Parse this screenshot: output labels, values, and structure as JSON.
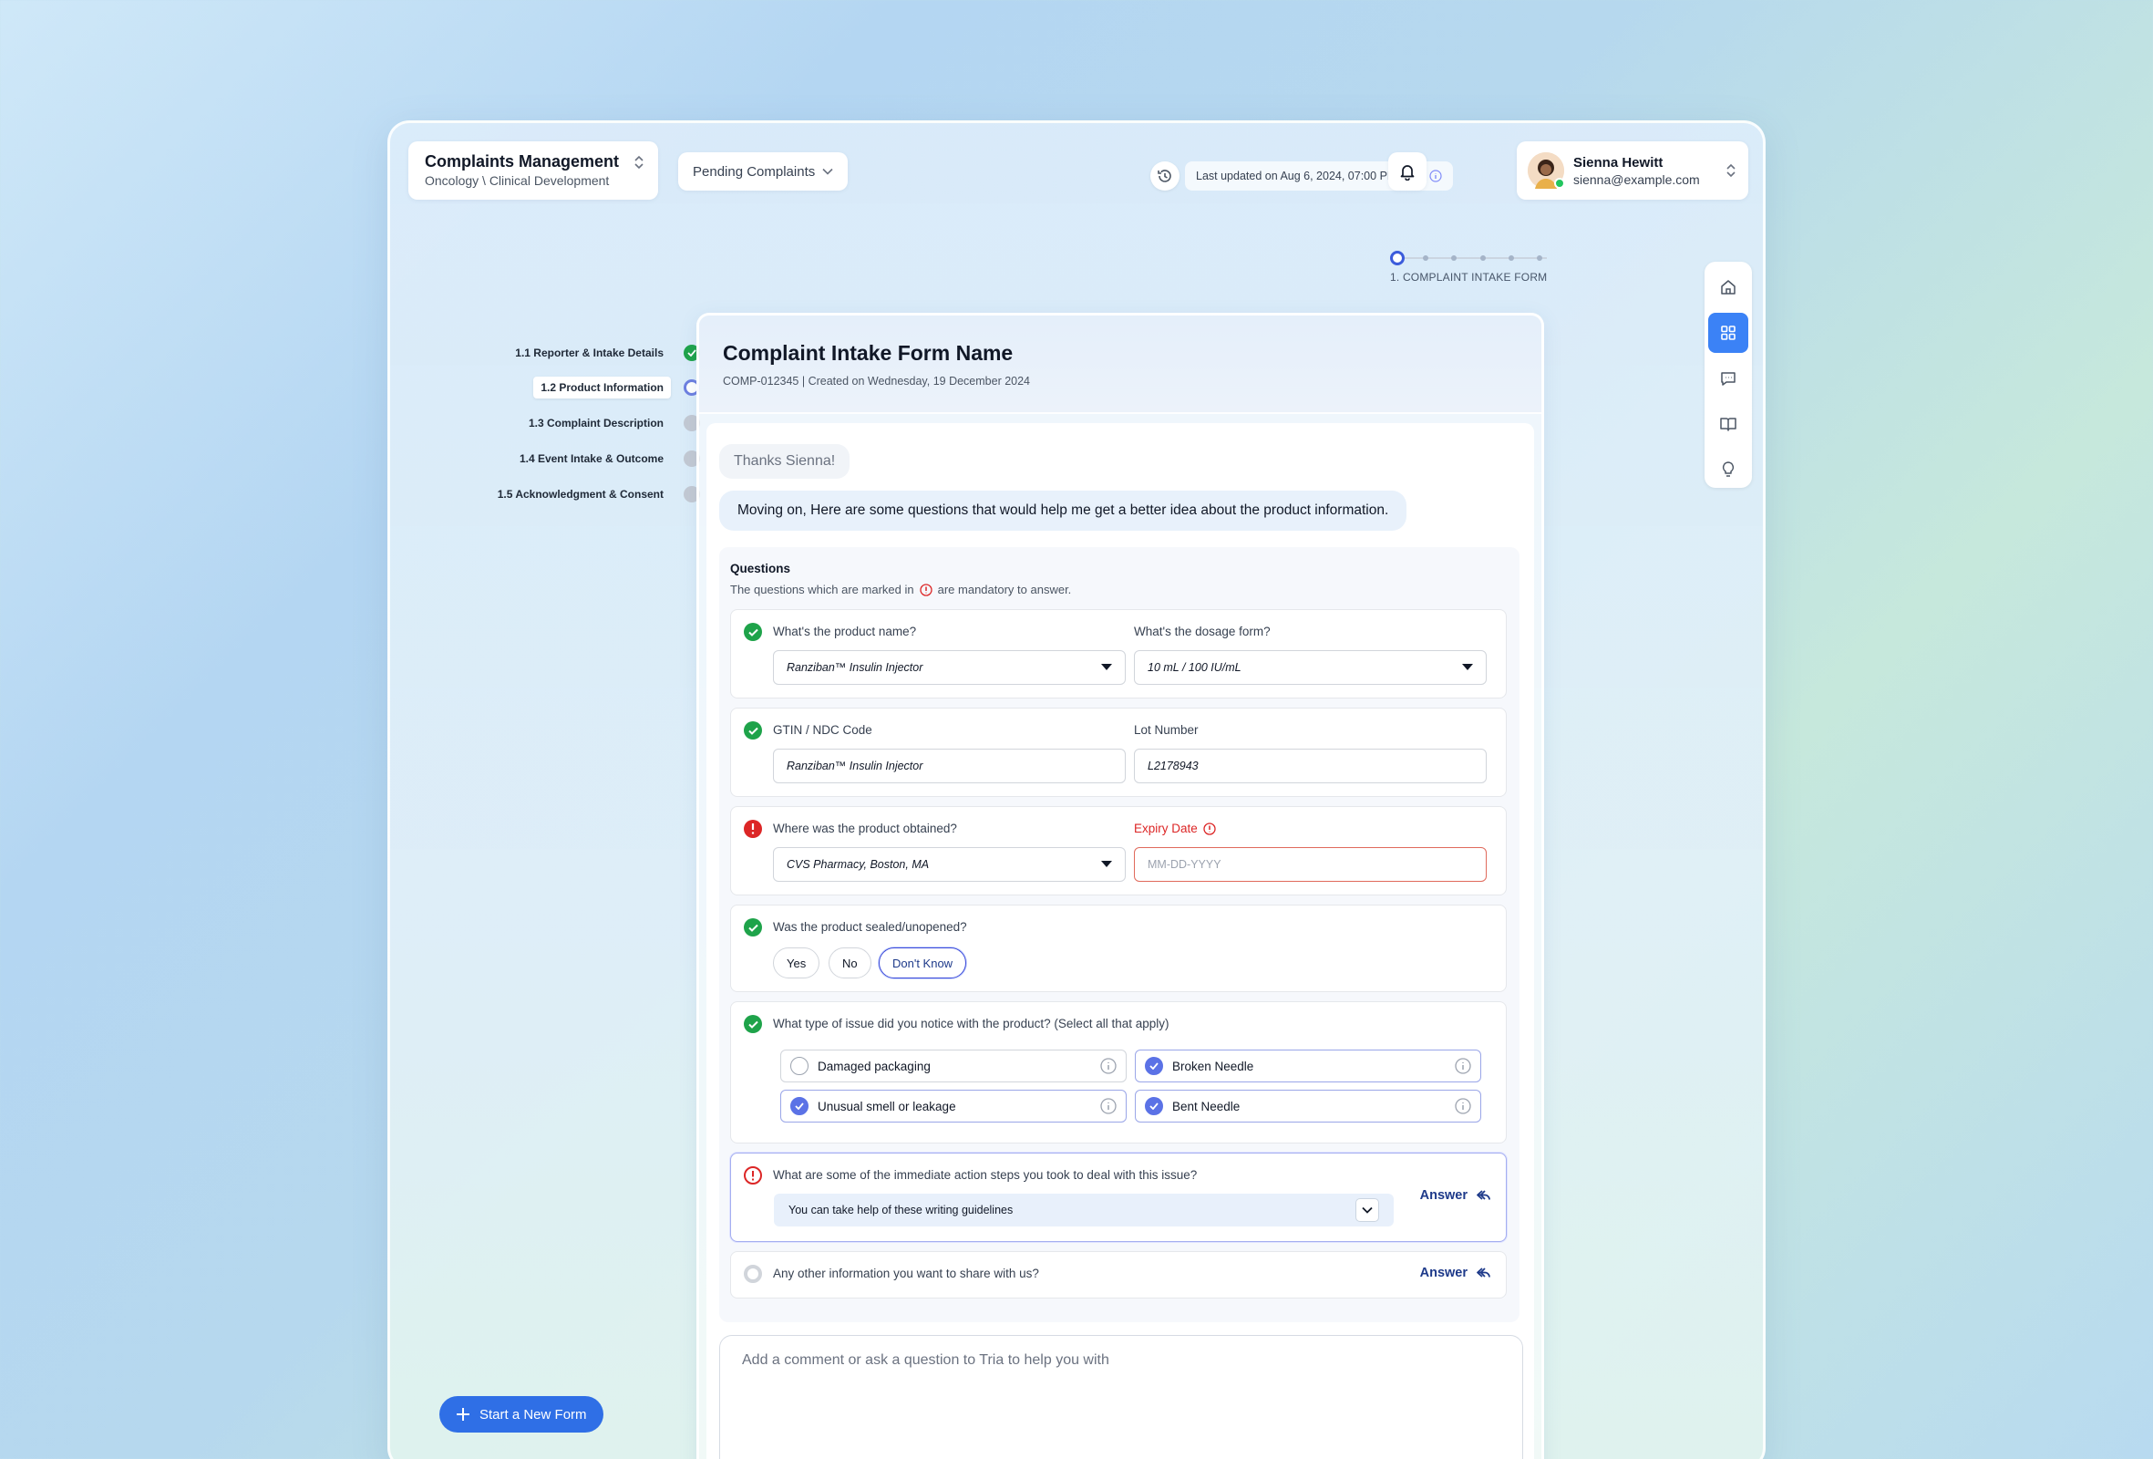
{
  "header": {
    "app_title": "Complaints Management",
    "breadcrumb": "Oncology \\ Clinical Development",
    "filter_label": "Pending Complaints",
    "last_updated": "Last updated on Aug 6, 2024, 07:00 PM EST",
    "user": {
      "name": "Sienna Hewitt",
      "email": "sienna@example.com"
    }
  },
  "stepper": {
    "label": "1. COMPLAINT INTAKE FORM",
    "total": 6,
    "current": 1
  },
  "side_steps": [
    {
      "label": "1.1 Reporter & Intake Details",
      "status": "done"
    },
    {
      "label": "1.2 Product Information",
      "status": "current"
    },
    {
      "label": "1.3 Complaint Description",
      "status": "todo"
    },
    {
      "label": "1.4 Event Intake & Outcome",
      "status": "todo"
    },
    {
      "label": "1.5 Acknowledgment & Consent",
      "status": "todo"
    }
  ],
  "new_form_label": "Start a New Form",
  "form": {
    "title": "Complaint Intake Form Name",
    "subtitle": "COMP-012345 | Created on Wednesday, 19 December 2024"
  },
  "chat": {
    "msg1": "Thanks Sienna!",
    "msg2": "Moving on, Here are some questions that would help me get a better idea about the product information."
  },
  "questions": {
    "title": "Questions",
    "note_before": "The questions which are marked in",
    "note_after": "are mandatory to answer.",
    "q1": {
      "label_a": "What's the product name?",
      "value_a": "Ranziban™ Insulin Injector",
      "label_b": "What's the dosage form?",
      "value_b": "10 mL / 100 IU/mL"
    },
    "q2": {
      "label_a": "GTIN / NDC Code",
      "value_a": "Ranziban™ Insulin Injector",
      "label_b": "Lot Number",
      "value_b": "L2178943"
    },
    "q3": {
      "label_a": "Where was the product obtained?",
      "value_a": "CVS Pharmacy, Boston, MA",
      "label_b": "Expiry Date",
      "placeholder_b": "MM-DD-YYYY"
    },
    "q4": {
      "label": "Was the product sealed/unopened?",
      "options": [
        "Yes",
        "No",
        "Don't Know"
      ],
      "selected": "Don't Know"
    },
    "q5": {
      "label": "What type of issue did you notice with the product? (Select all that apply)",
      "options": [
        {
          "label": "Damaged packaging",
          "checked": false
        },
        {
          "label": "Broken Needle",
          "checked": true
        },
        {
          "label": "Unusual smell or leakage",
          "checked": true
        },
        {
          "label": "Bent Needle",
          "checked": true
        }
      ]
    },
    "q6": {
      "label": "What are some of the immediate action steps you took to deal with this issue?",
      "guide": "You can take help of these writing guidelines",
      "answer": "Answer"
    },
    "q7": {
      "label": "Any other information you want to share with us?",
      "answer": "Answer"
    }
  },
  "composer": {
    "placeholder": "Add a comment or ask a question to Tria to help you with"
  },
  "colors": {
    "accent": "#2f6fe6",
    "success": "#1ea34a",
    "error": "#dc2626",
    "link": "#1e3a8a"
  }
}
